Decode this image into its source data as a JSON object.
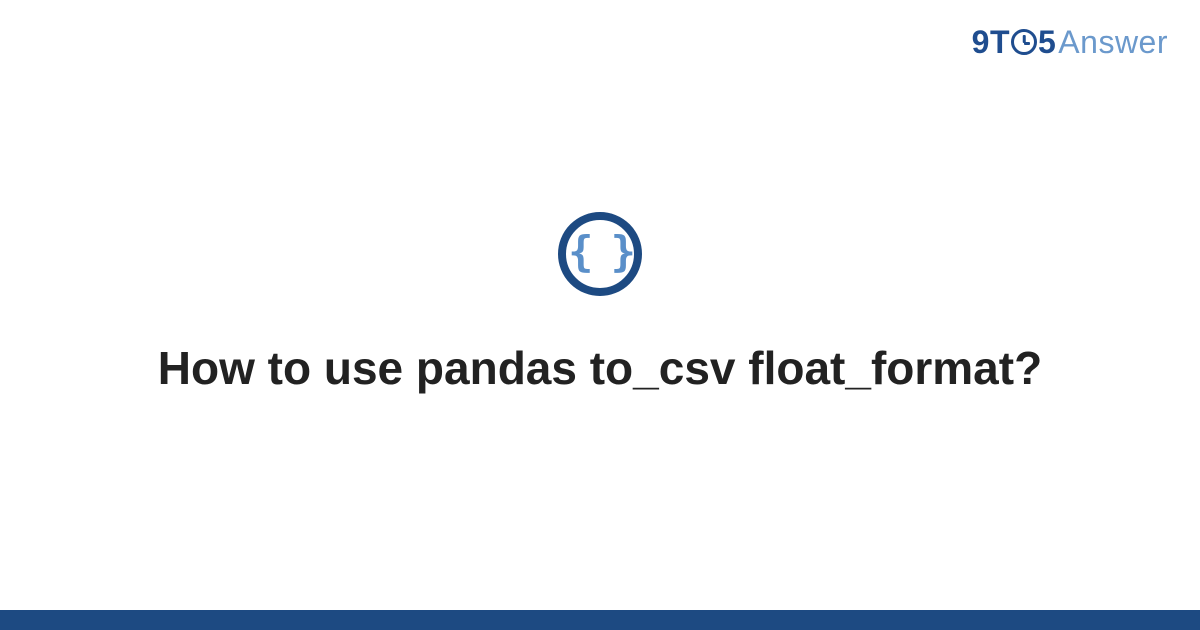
{
  "brand": {
    "part1": "9",
    "part2": "T",
    "part3": "5",
    "part4": "Answer"
  },
  "badge": {
    "glyph": "{ }"
  },
  "question": {
    "title": "How to use pandas to_csv float_format?"
  }
}
